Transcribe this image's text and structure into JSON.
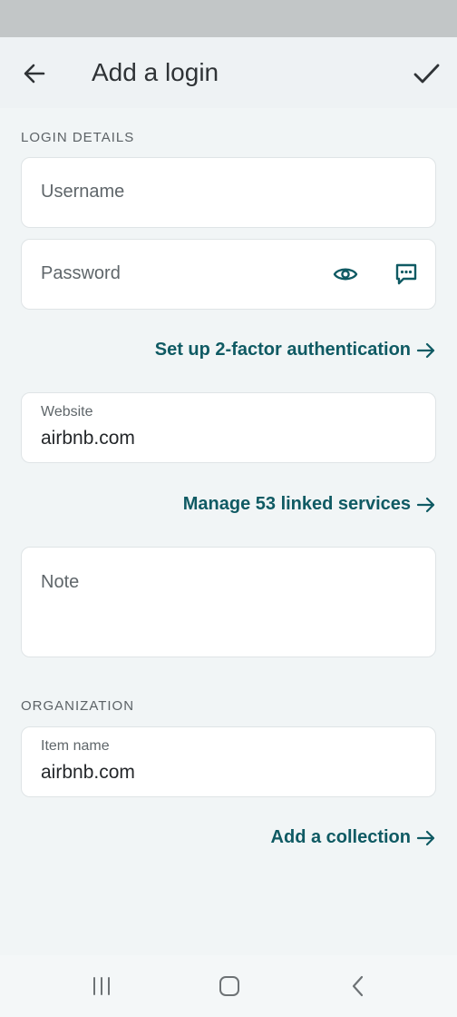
{
  "app_bar": {
    "title": "Add a login",
    "back_icon": "arrow-left-icon",
    "save_icon": "checkmark-icon"
  },
  "login_details": {
    "section_label": "LOGIN DETAILS",
    "username": {
      "placeholder": "Username",
      "value": ""
    },
    "password": {
      "placeholder": "Password",
      "value": "",
      "reveal_icon": "eye-icon",
      "generate_icon": "password-generator-icon"
    },
    "two_factor_link": "Set up 2-factor authentication",
    "website": {
      "label": "Website",
      "value": "airbnb.com"
    },
    "linked_services_link": "Manage 53 linked services",
    "note": {
      "placeholder": "Note",
      "value": ""
    }
  },
  "organization": {
    "section_label": "ORGANIZATION",
    "item_name": {
      "label": "Item name",
      "value": "airbnb.com"
    },
    "collection_link": "Add a collection"
  },
  "system_nav": {
    "recents_icon": "recent-apps-icon",
    "home_icon": "home-icon",
    "back_icon": "system-back-icon"
  },
  "colors": {
    "accent": "#0f5a63",
    "background": "#f1f5f6",
    "field_background": "#ffffff",
    "status_bar": "#c2c6c7"
  }
}
